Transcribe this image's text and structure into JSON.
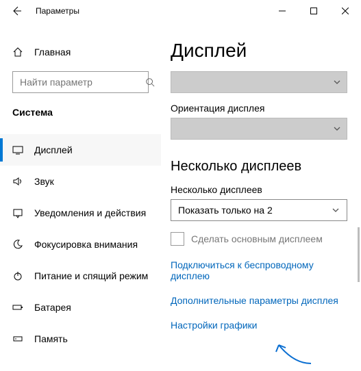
{
  "titlebar": {
    "title": "Параметры"
  },
  "sidebar": {
    "home_label": "Главная",
    "search_placeholder": "Найти параметр",
    "section_label": "Система",
    "items": [
      {
        "label": "Дисплей"
      },
      {
        "label": "Звук"
      },
      {
        "label": "Уведомления и действия"
      },
      {
        "label": "Фокусировка внимания"
      },
      {
        "label": "Питание и спящий режим"
      },
      {
        "label": "Батарея"
      },
      {
        "label": "Память"
      }
    ]
  },
  "content": {
    "page_title": "Дисплей",
    "orientation_label": "Ориентация дисплея",
    "multi_title": "Несколько дисплеев",
    "multi_label": "Несколько дисплеев",
    "multi_value": "Показать только на 2",
    "make_main_label": "Сделать основным дисплеем",
    "links": {
      "wireless": "Подключиться к беспроводному дисплею",
      "advanced": "Дополнительные параметры дисплея",
      "graphics": "Настройки графики"
    }
  }
}
